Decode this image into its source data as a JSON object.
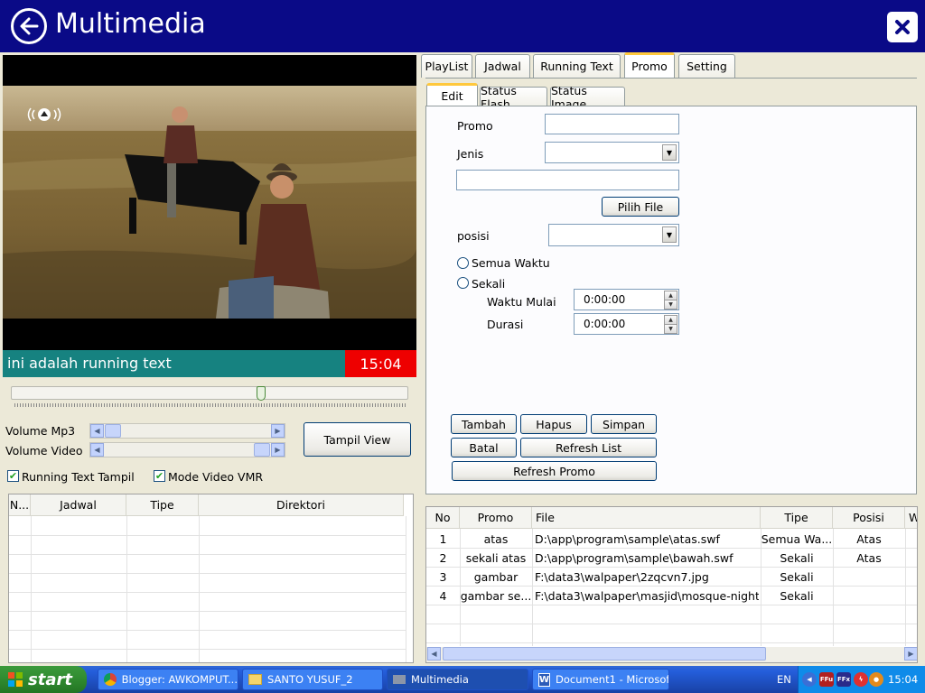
{
  "window": {
    "title": "Multimedia"
  },
  "player": {
    "running_text": "ini adalah running text",
    "clock": "15:04",
    "seek_fraction": 0.63
  },
  "controls": {
    "volume_mp3_label": "Volume Mp3",
    "volume_video_label": "Volume Video",
    "volume_mp3_level": 0.02,
    "volume_video_level": 0.98,
    "tampil_view": "Tampil View",
    "running_text_tampil": "Running Text Tampil",
    "mode_video_vmr": "Mode Video VMR",
    "running_text_tampil_checked": true,
    "mode_video_vmr_checked": true
  },
  "left_table": {
    "columns": [
      "N...",
      "Jadwal",
      "Tipe",
      "Direktori"
    ]
  },
  "tabs": [
    "PlayList",
    "Jadwal",
    "Running Text",
    "Promo",
    "Setting"
  ],
  "active_tab": "Promo",
  "subtabs": [
    "Edit",
    "Status Flash",
    "Status Image"
  ],
  "active_subtab": "Edit",
  "form": {
    "promo_label": "Promo",
    "promo_value": "",
    "jenis_label": "Jenis",
    "jenis_value": "",
    "file_value": "",
    "pilih_file": "Pilih File",
    "posisi_label": "posisi",
    "posisi_value": "",
    "semua_waktu": "Semua Waktu",
    "sekali": "Sekali",
    "waktu_mulai_label": "Waktu Mulai",
    "waktu_mulai_value": "0:00:00",
    "durasi_label": "Durasi",
    "durasi_value": "0:00:00"
  },
  "buttons": {
    "tambah": "Tambah",
    "hapus": "Hapus",
    "simpan": "Simpan",
    "batal": "Batal",
    "refresh_list": "Refresh List",
    "refresh_promo": "Refresh Promo"
  },
  "promo_table": {
    "columns": [
      "No",
      "Promo",
      "File",
      "Tipe",
      "Posisi",
      "W"
    ],
    "rows": [
      [
        "1",
        "atas",
        "D:\\app\\program\\sample\\atas.swf",
        "Semua Wa...",
        "Atas"
      ],
      [
        "2",
        "sekali atas",
        "D:\\app\\program\\sample\\bawah.swf",
        "Sekali",
        "Atas"
      ],
      [
        "3",
        "gambar",
        "F:\\data3\\walpaper\\2zqcvn7.jpg",
        "Sekali",
        ""
      ],
      [
        "4",
        "gambar se...",
        "F:\\data3\\walpaper\\masjid\\mosque-night...",
        "Sekali",
        ""
      ]
    ]
  },
  "taskbar": {
    "start": "start",
    "tasks": [
      "Blogger: AWKOMPUT...",
      "SANTO YUSUF_2",
      "Multimedia",
      "Document1 - Microsof..."
    ],
    "active_task": "Multimedia",
    "lang": "EN",
    "time": "15:04"
  },
  "colors": {
    "title_bar": "#0a0a87",
    "running_bar": "#168280",
    "clock_bg": "#ee0000",
    "taskbar": "#245edb",
    "start": "#2f8a2f"
  }
}
